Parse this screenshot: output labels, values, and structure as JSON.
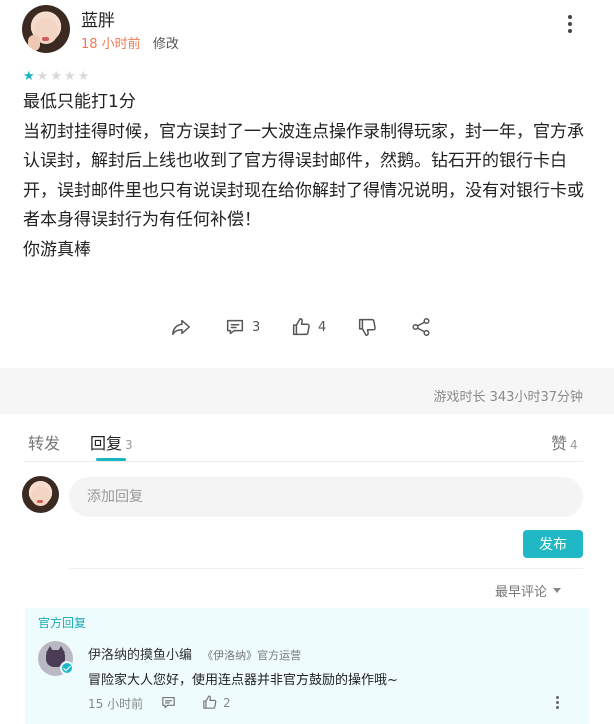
{
  "review": {
    "username": "蓝胖",
    "time": "18 小时前",
    "edit_label": "修改",
    "rating": 1,
    "rating_max": 5,
    "paragraphs": [
      "最低只能打1分",
      "当初封挂得时候，官方误封了一大波连点操作录制得玩家，封一年，官方承认误封，解封后上线也收到了官方得误封邮件，然鹅。钻石开的银行卡白开，误封邮件里也只有说误封现在给你解封了得情况说明，没有对银行卡或者本身得误封行为有任何补偿！",
      "你游真棒"
    ],
    "actions": {
      "comments": "3",
      "likes": "4"
    }
  },
  "playtime": "游戏时长 343小时37分钟",
  "tabs": {
    "repost": "转发",
    "reply": "回复",
    "reply_count": "3",
    "like": "赞",
    "like_count": "4"
  },
  "reply_box": {
    "placeholder": "添加回复",
    "publish_label": "发布"
  },
  "sort_label": "最早评论",
  "official_reply": {
    "label": "官方回复",
    "name": "伊洛纳的摸鱼小编",
    "game": "《伊洛纳》官方运营",
    "text": "冒险家大人您好，使用连点器并非官方鼓励的操作哦~",
    "time": "15 小时前",
    "likes": "2"
  },
  "colors": {
    "accent": "#21b8c6",
    "time_highlight": "#f07a55"
  }
}
